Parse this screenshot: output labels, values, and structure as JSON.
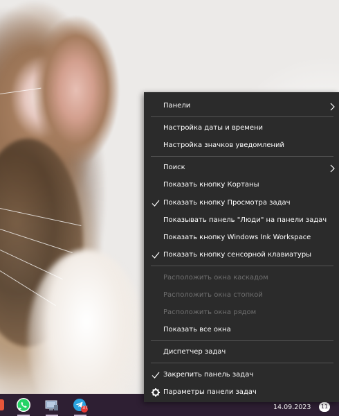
{
  "context_menu": {
    "items": [
      {
        "label": "Панели",
        "submenu": true
      },
      {
        "label": "Настройка даты и времени"
      },
      {
        "label": "Настройка значков уведомлений"
      },
      {
        "label": "Поиск",
        "submenu": true
      },
      {
        "label": "Показать кнопку Кортаны"
      },
      {
        "label": "Показать кнопку Просмотра задач",
        "checked": true
      },
      {
        "label": "Показывать панель \"Люди\" на панели задач"
      },
      {
        "label": "Показать кнопку Windows Ink Workspace"
      },
      {
        "label": "Показать кнопку сенсорной клавиатуры",
        "checked": true
      },
      {
        "label": "Расположить окна каскадом",
        "disabled": true
      },
      {
        "label": "Расположить окна стопкой",
        "disabled": true
      },
      {
        "label": "Расположить окна рядом",
        "disabled": true
      },
      {
        "label": "Показать все окна"
      },
      {
        "label": "Диспетчер задач"
      },
      {
        "label": "Закрепить панель задач",
        "checked": true
      },
      {
        "label": "Параметры панели задач",
        "icon": "gear-icon"
      }
    ]
  },
  "taskbar": {
    "apps": [
      {
        "name": "whatsapp-icon"
      },
      {
        "name": "computer-icon"
      },
      {
        "name": "telegram-icon",
        "badge": "37"
      }
    ],
    "date": "14.09.2023",
    "notifications_count": "11"
  },
  "colors": {
    "menu_bg": "#2b2b2b",
    "menu_text": "#ffffff",
    "menu_disabled_text": "#6f6f6f",
    "taskbar_bg": "#2e1f33"
  }
}
